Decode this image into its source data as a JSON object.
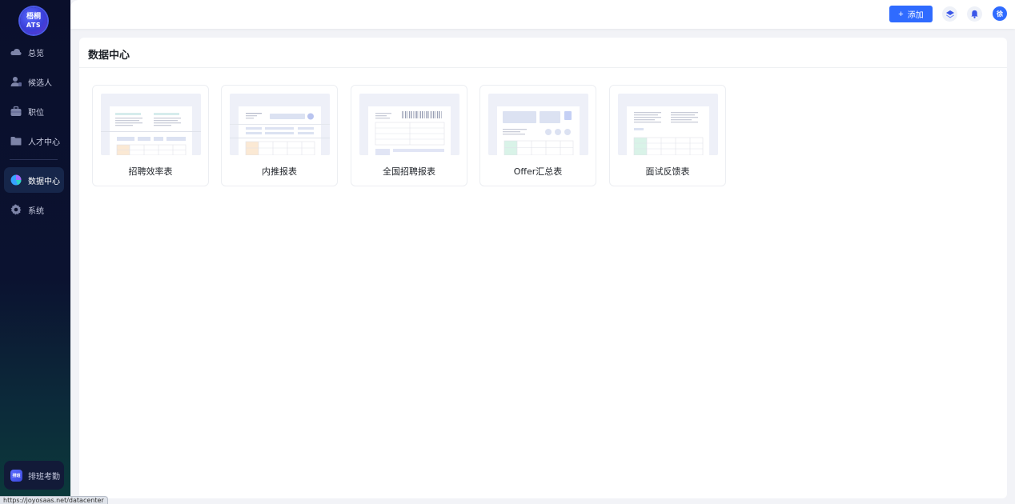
{
  "sidebar": {
    "logo": {
      "line1": "梧桐",
      "line2": "ATS"
    },
    "items": [
      {
        "label": "总览",
        "icon": "cloud-icon"
      },
      {
        "label": "候选人",
        "icon": "user-icon"
      },
      {
        "label": "职位",
        "icon": "briefcase-icon"
      },
      {
        "label": "人才中心",
        "icon": "folder-icon"
      },
      {
        "label": "数据中心",
        "icon": "pie-chart-icon",
        "active": true
      },
      {
        "label": "系统",
        "icon": "gear-icon"
      }
    ],
    "bottom_app": {
      "badge": "排班",
      "label": "排班考勤"
    }
  },
  "header": {
    "add_label": "添加",
    "icons": [
      "layers-icon",
      "bell-icon"
    ],
    "avatar_text": "徐"
  },
  "main": {
    "title": "数据中心",
    "cards": [
      {
        "label": "招聘效率表"
      },
      {
        "label": "内推报表"
      },
      {
        "label": "全国招聘报表"
      },
      {
        "label": "Offer汇总表"
      },
      {
        "label": "面试反馈表"
      }
    ]
  },
  "status_url": "https://joyosaas.net/datacenter",
  "colors": {
    "accent": "#2f6bff",
    "sidebar_bg": "#0a0f2b",
    "thumb_bg": "#eef0f8"
  }
}
